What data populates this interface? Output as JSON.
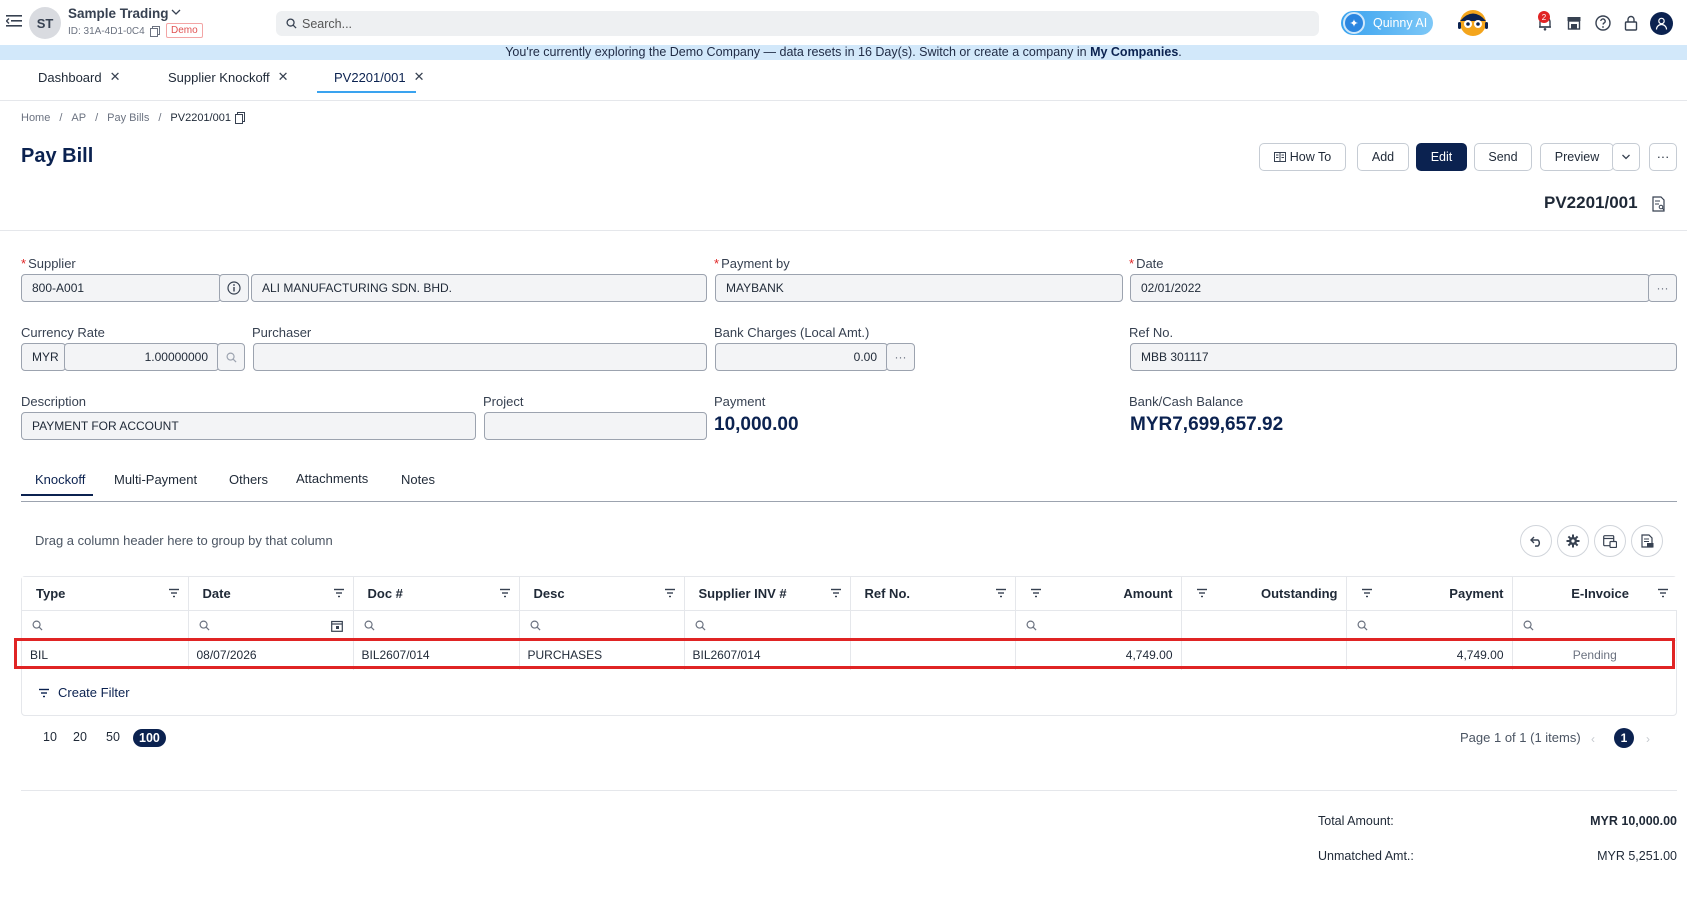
{
  "header": {
    "avatar_initials": "ST",
    "company_name": "Sample Trading",
    "company_id": "ID: 31A-4D1-0C4",
    "demo_badge": "Demo",
    "search_placeholder": "Search...",
    "ai_label": "Quinny AI",
    "notification_count": "2"
  },
  "banner": {
    "text": "You're currently exploring the Demo Company — data resets in 16 Day(s). Switch or create a company in ",
    "link": "My Companies",
    "suffix": "."
  },
  "page_tabs": [
    {
      "label": "Dashboard"
    },
    {
      "label": "Supplier Knockoff"
    },
    {
      "label": "PV2201/001",
      "active": true
    }
  ],
  "breadcrumb": [
    "Home",
    "AP",
    "Pay Bills",
    "PV2201/001"
  ],
  "page_title": "Pay Bill",
  "toolbar": {
    "howto": "How To",
    "add": "Add",
    "edit": "Edit",
    "send": "Send",
    "preview": "Preview",
    "more": "···"
  },
  "doc_number": "PV2201/001",
  "form": {
    "supplier_label": "Supplier",
    "supplier_code": "800-A001",
    "supplier_name": "ALI MANUFACTURING SDN. BHD.",
    "payment_by_label": "Payment by",
    "payment_by": "MAYBANK",
    "date_label": "Date",
    "date": "02/01/2022",
    "currency_rate_label": "Currency Rate",
    "currency": "MYR",
    "rate": "1.00000000",
    "purchaser_label": "Purchaser",
    "purchaser": "",
    "bank_charges_label": "Bank Charges (Local Amt.)",
    "bank_charges": "0.00",
    "ref_no_label": "Ref No.",
    "ref_no": "MBB 301117",
    "description_label": "Description",
    "description": "PAYMENT FOR ACCOUNT",
    "project_label": "Project",
    "project": "",
    "payment_label": "Payment",
    "payment": "10,000.00",
    "bank_balance_label": "Bank/Cash Balance",
    "bank_balance": "MYR7,699,657.92"
  },
  "sub_tabs": [
    "Knockoff",
    "Multi-Payment",
    "Others",
    "Attachments",
    "Notes"
  ],
  "grid": {
    "group_hint": "Drag a column header here to group by that column",
    "columns": [
      "Type",
      "Date",
      "Doc #",
      "Desc",
      "Supplier INV #",
      "Ref No.",
      "Amount",
      "Outstanding",
      "Payment",
      "E-Invoice"
    ],
    "rows": [
      {
        "type": "BIL",
        "date": "08/07/2026",
        "doc": "BIL2607/014",
        "desc": "PURCHASES",
        "supplier_inv": "BIL2607/014",
        "ref_no": "",
        "amount": "4,749.00",
        "outstanding": "",
        "payment": "4,749.00",
        "einvoice": "Pending"
      }
    ],
    "create_filter": "Create Filter"
  },
  "pagination": {
    "sizes": [
      "10",
      "20",
      "50",
      "100"
    ],
    "active_size": "100",
    "info": "Page 1 of 1 (1 items)",
    "current_page": "1"
  },
  "totals": {
    "total_amount_label": "Total Amount:",
    "total_amount": "MYR 10,000.00",
    "unmatched_label": "Unmatched Amt.:",
    "unmatched": "MYR 5,251.00"
  }
}
